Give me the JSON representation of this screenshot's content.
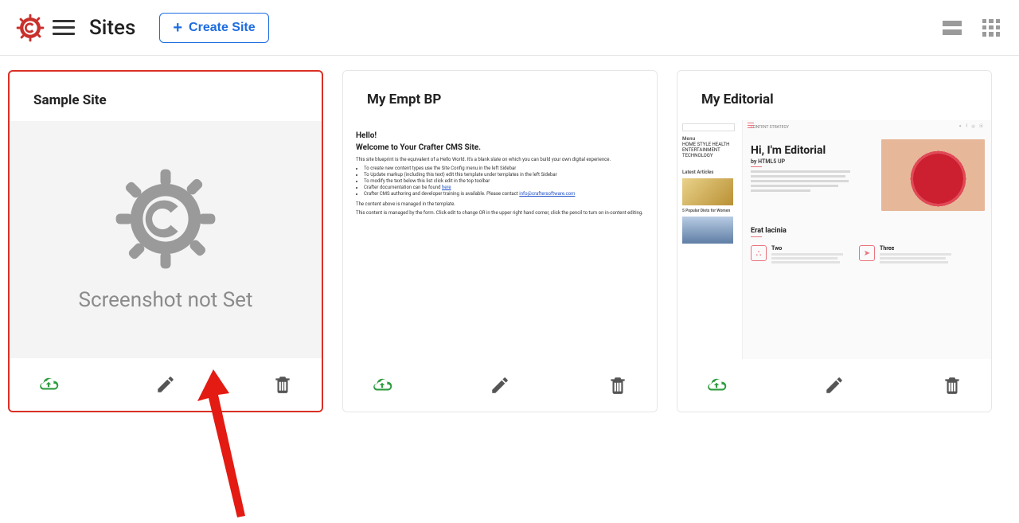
{
  "header": {
    "title": "Sites",
    "create_label": "Create Site"
  },
  "cards": [
    {
      "title": "Sample Site",
      "placeholder_text": "Screenshot not Set"
    },
    {
      "title": "My Empt BP",
      "doc": {
        "h1": "Hello!",
        "h2": "Welcome to Your Crafter CMS Site.",
        "intro": "This site blueprint is the equivalent of a Hello World. It's a blank slate on which you can build your own digital experience.",
        "bullets": [
          "To create new content types use the Site Config menu in the left Sidebar",
          "To Update markup (including this text) edit this template under templates in the left Sidebar",
          "To modify the text below this list click edit in the top toolbar",
          "Crafter documentation can be found ",
          "Crafter CMS authoring and developer training is available. Please contact "
        ],
        "link_here": "here",
        "link_email": "info@craftersoftware.com",
        "p1": "The content above is managed in the template.",
        "p2": "This content is managed by the form.  Click edit to change OR in the upper right hand corner, click the pencil to turn on in-content editing."
      }
    },
    {
      "title": "My Editorial",
      "ed": {
        "crumb": "CONTENT STRATEGY",
        "menu_heading": "Menu",
        "menu": [
          "HOME",
          "STYLE",
          "HEALTH",
          "ENTERTAINMENT",
          "TECHNOLOGY"
        ],
        "articles_heading": "Latest Articles",
        "popular_heading": "5 Popular Diets for Women",
        "h1": "Hi, I'm Editorial",
        "sub": "by HTML5 UP",
        "sec": "Erat lacinia",
        "feat1": "Two",
        "feat2": "Three"
      }
    }
  ]
}
